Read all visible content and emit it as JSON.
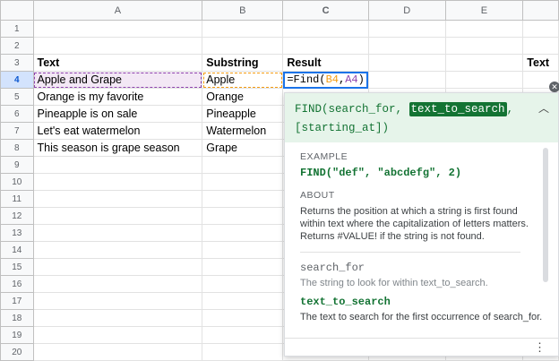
{
  "columns": [
    "A",
    "B",
    "C",
    "D",
    "E",
    ""
  ],
  "rows": [
    "1",
    "2",
    "3",
    "4",
    "5",
    "6",
    "7",
    "8",
    "9",
    "10",
    "11",
    "12",
    "13",
    "14",
    "15",
    "16",
    "17",
    "18",
    "19",
    "20"
  ],
  "cells": {
    "A3": "Text",
    "B3": "Substring",
    "C3": "Result",
    "F3": "Text",
    "A4": "Apple and Grape",
    "B4": "Apple",
    "A5": "Orange is my favorite",
    "B5": "Orange",
    "A6": "Pineapple is on sale",
    "B6": "Pineapple",
    "A7": "Let's eat watermelon",
    "B7": "Watermelon",
    "A8": "This season is grape season",
    "B8": "Grape"
  },
  "formula": {
    "prefix": "=Find(",
    "arg1": "B4",
    "sep": ",",
    "arg2": "A4",
    "suffix": ")"
  },
  "help": {
    "sig_start": "FIND(search_for, ",
    "sig_hl": "text_to_search",
    "sig_end": ",",
    "sig_line2": "[starting_at])",
    "example_label": "EXAMPLE",
    "example": "FIND(\"def\", \"abcdefg\", 2)",
    "about_label": "ABOUT",
    "about": "Returns the position at which a string is first found within text where the capitalization of letters matters. Returns #VALUE! if the string is not found.",
    "p1_name": "search_for",
    "p1_desc": "The string to look for within text_to_search.",
    "p2_name": "text_to_search",
    "p2_desc": "The text to search for the first occurrence of search_for."
  }
}
